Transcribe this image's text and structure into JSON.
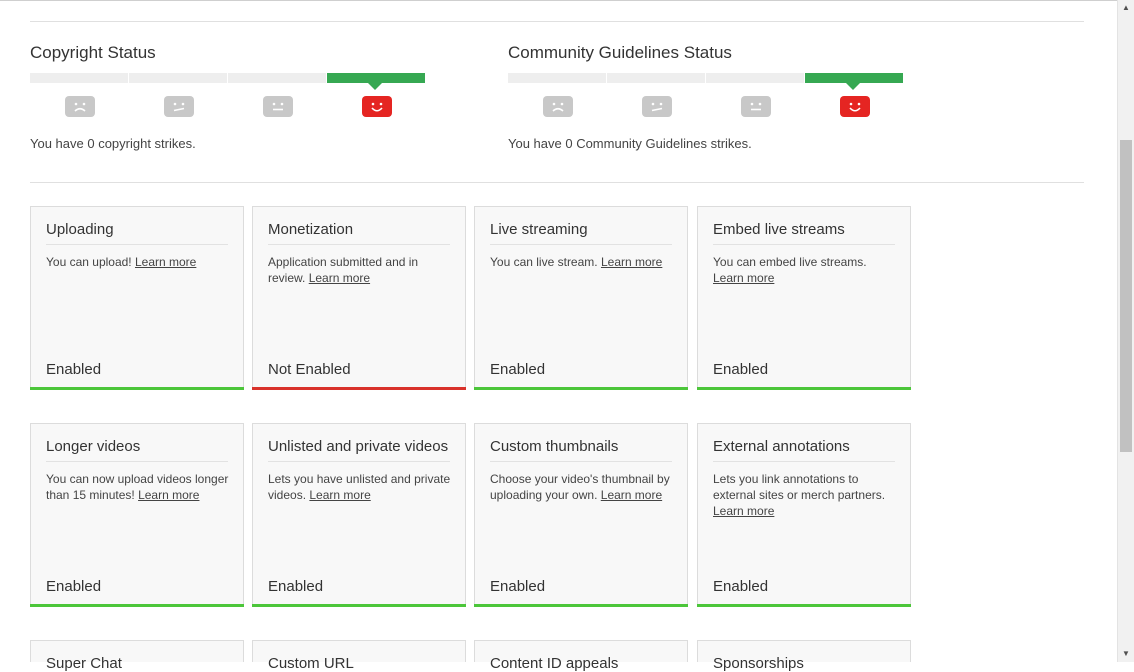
{
  "copyright": {
    "title": "Copyright Status",
    "strikes_text": "You have 0 copyright strikes.",
    "active_level": 4
  },
  "community": {
    "title": "Community Guidelines Status",
    "strikes_text": "You have 0 Community Guidelines strikes.",
    "active_level": 4
  },
  "learn_more": "Learn more",
  "colors": {
    "enabled": "#4cc63a",
    "not_enabled": "#d9322b",
    "active_meter": "#36a852",
    "face_red": "#e52522"
  },
  "features": [
    {
      "title": "Uploading",
      "desc": "You can upload!",
      "state": "Enabled",
      "enabled": true
    },
    {
      "title": "Monetization",
      "desc": "Application submitted and in review.",
      "state": "Not Enabled",
      "enabled": false
    },
    {
      "title": "Live streaming",
      "desc": "You can live stream.",
      "state": "Enabled",
      "enabled": true
    },
    {
      "title": "Embed live streams",
      "desc": "You can embed live streams.",
      "state": "Enabled",
      "enabled": true
    },
    {
      "title": "Longer videos",
      "desc": "You can now upload videos longer than 15 minutes!",
      "state": "Enabled",
      "enabled": true
    },
    {
      "title": "Unlisted and private videos",
      "desc": "Lets you have unlisted and private videos.",
      "state": "Enabled",
      "enabled": true
    },
    {
      "title": "Custom thumbnails",
      "desc": "Choose your video's thumbnail by uploading your own.",
      "state": "Enabled",
      "enabled": true
    },
    {
      "title": "External annotations",
      "desc": "Lets you link annotations to external sites or merch partners.",
      "state": "Enabled",
      "enabled": true
    },
    {
      "title": "Super Chat"
    },
    {
      "title": "Custom URL"
    },
    {
      "title": "Content ID appeals"
    },
    {
      "title": "Sponsorships"
    }
  ]
}
